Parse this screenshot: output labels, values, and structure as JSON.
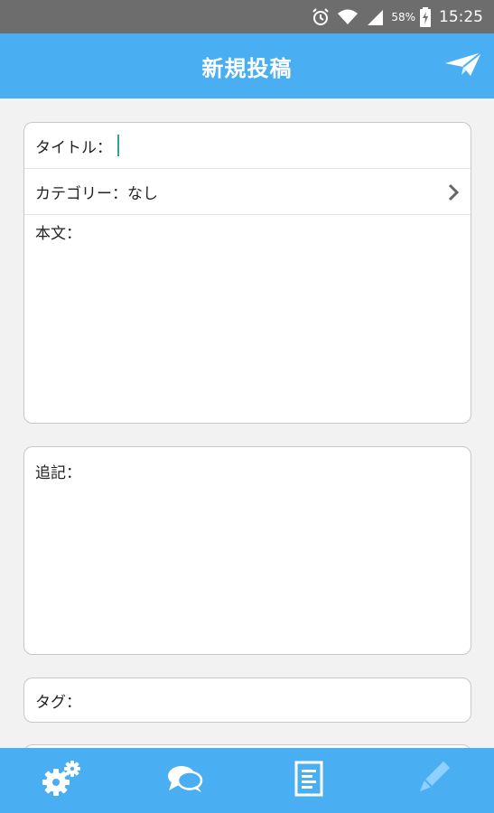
{
  "status_bar": {
    "battery": "58%",
    "time": "15:25",
    "icons": [
      "alarm-icon",
      "wifi-icon",
      "signal-icon",
      "battery-charging-icon"
    ]
  },
  "app_bar": {
    "title": "新規投稿",
    "action_icon": "send-paper-plane-icon"
  },
  "form": {
    "title_label": "タイトル：",
    "category_label": "カテゴリー：",
    "category_value": "なし",
    "body_label": "本文：",
    "postscript_label": "追記：",
    "tags_label": "タグ："
  },
  "bottom_nav": {
    "items": [
      {
        "icon": "settings-gears-icon"
      },
      {
        "icon": "chat-bubbles-icon"
      },
      {
        "icon": "document-list-icon"
      },
      {
        "icon": "pencil-icon",
        "active": false
      }
    ]
  },
  "colors": {
    "primary": "#4aaef2",
    "status_bar": "#6d6d6d",
    "background": "#f2f2f2",
    "cursor": "#2aa59a"
  }
}
